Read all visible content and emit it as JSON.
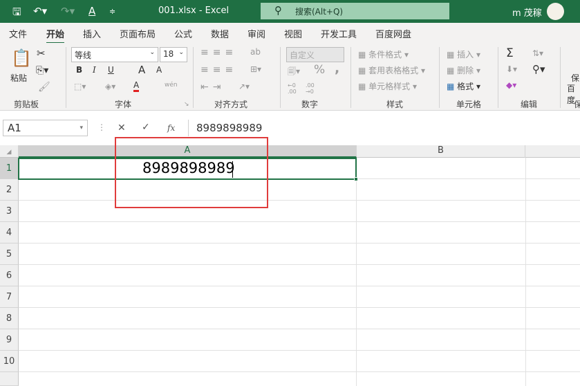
{
  "title_bar": {
    "file_title": "001.xlsx  -  Excel",
    "search_placeholder": "搜索(Alt+Q)",
    "user": "m 茂稼",
    "icons": [
      "save-icon",
      "undo-icon",
      "redo-icon",
      "font-color-icon",
      "customize-qat-icon",
      "search-icon",
      "avatar"
    ]
  },
  "tabs": [
    "文件",
    "开始",
    "插入",
    "页面布局",
    "公式",
    "数据",
    "审阅",
    "视图",
    "开发工具",
    "百度网盘"
  ],
  "active_tab": "开始",
  "ribbon": {
    "clipboard": {
      "paste": "粘贴",
      "label": "剪贴板"
    },
    "font": {
      "name": "等线",
      "size": "18",
      "bold": "B",
      "italic": "I",
      "underline": "U",
      "grow": "A",
      "shrink": "A",
      "label": "字体",
      "phonetic": "wén"
    },
    "alignment": {
      "label": "对齐方式"
    },
    "number": {
      "format": "自定义",
      "percent": "%",
      "comma": ",",
      "inc": "←0 .00",
      "dec": ".00 →0",
      "label": "数字"
    },
    "styles": {
      "conditional": "条件格式",
      "table": "套用表格格式",
      "cell": "单元格样式",
      "label": "样式"
    },
    "cells": {
      "insert": "插入",
      "delete": "删除",
      "format": "格式",
      "label": "单元格"
    },
    "editing": {
      "sum": "Σ",
      "label": "编辑"
    },
    "baidu": {
      "line1": "保",
      "line2": "百度",
      "label": "保"
    }
  },
  "formula_bar": {
    "name_box": "A1",
    "cancel": "✕",
    "enter": "✓",
    "fx": "fx",
    "value": "8989898989"
  },
  "sheet": {
    "columns": [
      "A",
      "B"
    ],
    "rows": [
      "1",
      "2",
      "3",
      "4",
      "5",
      "6",
      "7",
      "8",
      "9",
      "10"
    ],
    "active_cell": "A1",
    "a1_value": "8989898989"
  },
  "colors": {
    "title_green": "#1f6f43",
    "selection": "#217346",
    "highlight_box": "#e03c3c"
  }
}
